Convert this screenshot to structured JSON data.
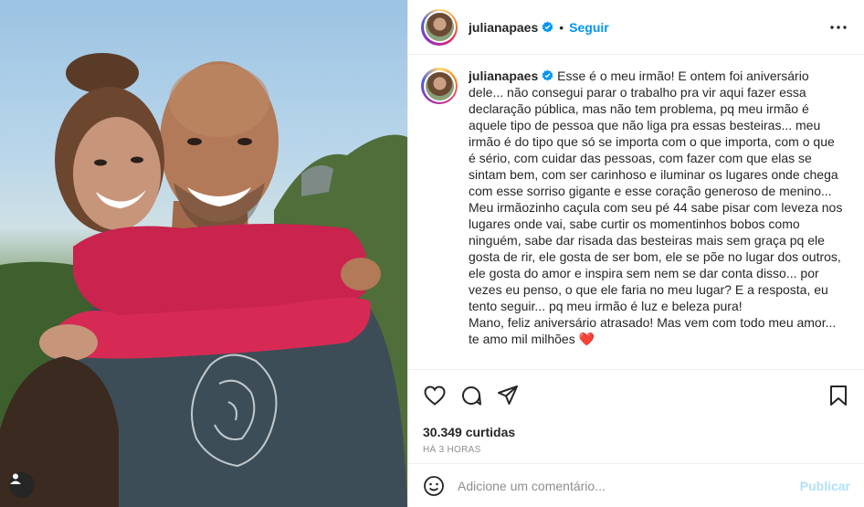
{
  "post": {
    "username": "julianapaes",
    "follow_label": "Seguir",
    "separator": "•",
    "caption": "Esse é o meu irmão! E ontem foi aniversário dele... não consegui parar o trabalho pra vir aqui fazer essa declaração pública, mas não tem problema, pq meu irmão é aquele tipo de pessoa que não liga pra essas besteiras... meu irmão é do tipo que só se importa com o que importa, com o que é sério, com cuidar das pessoas, com fazer com que elas se sintam bem, com ser carinhoso e iluminar os lugares onde chega com esse sorriso gigante e esse coração generoso de menino... Meu irmãozinho caçula com seu pé 44 sabe pisar com leveza nos lugares onde vai, sabe curtir os momentinhos bobos como ninguém, sabe dar risada das besteiras mais sem graça pq ele gosta de rir, ele gosta de ser bom, ele se põe no lugar dos outros, ele gosta do amor e inspira sem nem se dar conta disso... por vezes eu penso, o que ele faria no meu lugar? E a resposta, eu tento seguir... pq meu irmão é luz e beleza pura!\nMano, feliz aniversário atrasado! Mas vem com todo meu amor... te amo mil milhões ❤️",
    "likes": "30.349 curtidas",
    "time": "HÁ 3 HORAS"
  },
  "comment": {
    "placeholder": "Adicione um comentário...",
    "publish_label": "Publicar"
  },
  "colors": {
    "accent": "#0095f6",
    "publish_disabled": "#b2dffc",
    "muted": "#8e8e8e",
    "text": "#262626"
  },
  "icons": [
    "verified-badge-icon",
    "more-options-icon",
    "heart-icon",
    "comment-icon",
    "share-icon",
    "bookmark-icon",
    "emoji-icon",
    "user-tag-icon"
  ]
}
